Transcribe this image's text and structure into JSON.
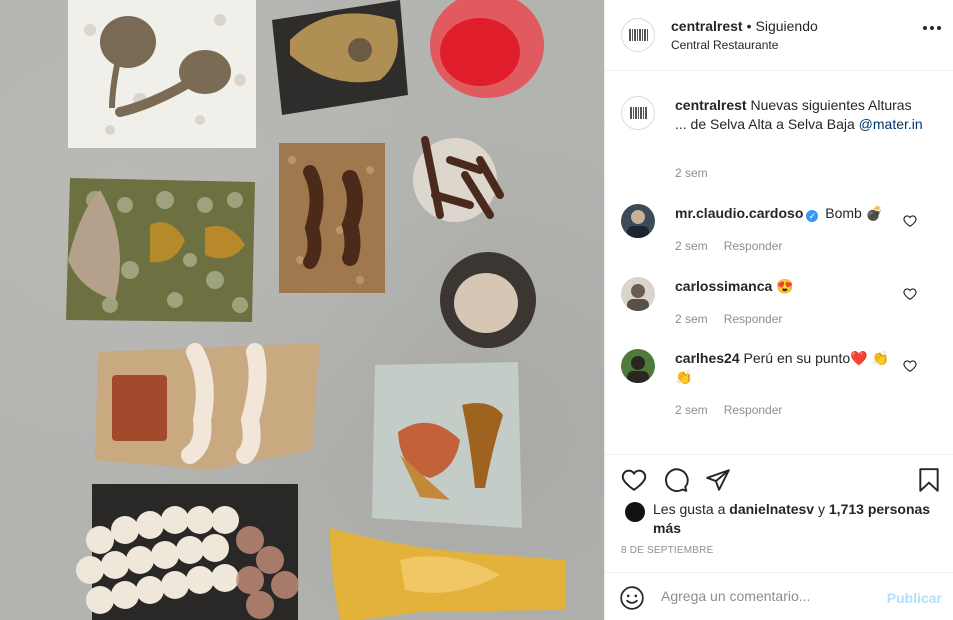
{
  "photo": {
    "alt_icon": "food-plates-photo"
  },
  "header": {
    "username": "centralrest",
    "separator": "•",
    "follow_state": "Siguiendo",
    "location": "Central Restaurante",
    "more_icon": "ellipsis-icon"
  },
  "caption": {
    "username": "centralrest",
    "text": "Nuevas siguientes Alturas ... de Selva Alta a Selva Baja",
    "mention": "@mater.in",
    "time": "2 sem"
  },
  "comments": [
    {
      "username": "mr.claudio.cardoso",
      "verified": true,
      "text": "Bomb 💣",
      "time": "2 sem",
      "reply": "Responder"
    },
    {
      "username": "carlossimanca",
      "verified": false,
      "text": "😍",
      "time": "2 sem",
      "reply": "Responder"
    },
    {
      "username": "carlhes24",
      "verified": false,
      "text": "Perú en su punto❤️ 👏👏",
      "time": "2 sem",
      "reply": "Responder"
    }
  ],
  "likes": {
    "prefix": "Les gusta a",
    "first_user": "danielnatesv",
    "connector": "y",
    "others": "1,713 personas más"
  },
  "date": "8 DE SEPTIEMBRE",
  "compose": {
    "placeholder": "Agrega un comentario...",
    "publish_label": "Publicar"
  },
  "colors": {
    "link": "#00376b",
    "publish_disabled": "#b2dffc",
    "verified": "#3897f0",
    "meta": "#8e8e8e"
  }
}
